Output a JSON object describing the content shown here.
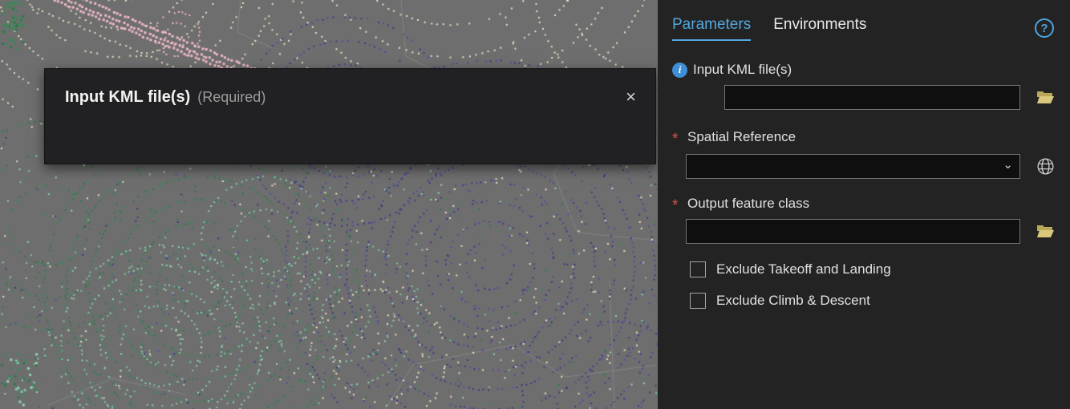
{
  "tooltip": {
    "title": "Input KML file(s)",
    "required": "(Required)"
  },
  "panel": {
    "tabs": [
      {
        "label": "Parameters",
        "active": true
      },
      {
        "label": "Environments",
        "active": false
      }
    ],
    "fields": [
      {
        "label": "Input KML file(s)",
        "required": false,
        "type": "file-input",
        "value": "",
        "icon": "folder-icon"
      },
      {
        "label": "Spatial Reference",
        "required": true,
        "type": "dropdown",
        "value": "",
        "icon": "globe-icon"
      },
      {
        "label": "Output feature class",
        "required": true,
        "type": "file-input",
        "value": "",
        "icon": "folder-icon"
      }
    ],
    "checkboxes": [
      {
        "label": "Exclude Takeoff and Landing",
        "checked": false
      },
      {
        "label": "Exclude Climb & Descent",
        "checked": false
      }
    ]
  },
  "icons": {
    "info": "i",
    "help": "?",
    "close": "×",
    "chevron": "⌄",
    "asterisk": "*"
  },
  "colors": {
    "accent": "#54a7dd",
    "asterisk": "#d9534a",
    "folder": "#d9c87c",
    "panel_bg": "#232323",
    "map_bg": "#6e6e6e"
  }
}
